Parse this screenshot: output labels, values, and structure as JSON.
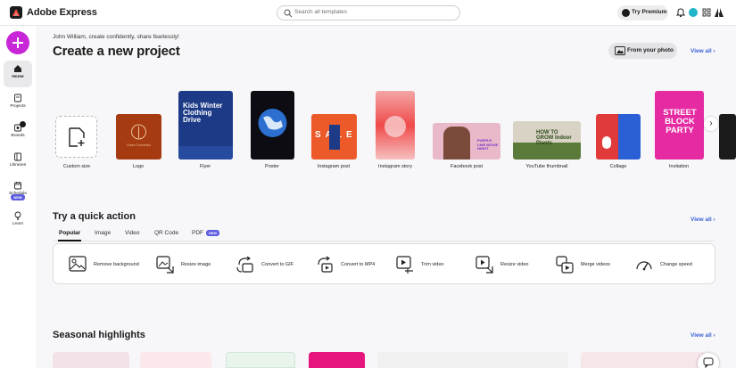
{
  "app": {
    "name": "Adobe Express"
  },
  "header": {
    "search_placeholder": "Search all templates",
    "premium_label": "Try Premium"
  },
  "sidebar": {
    "create_label": "+",
    "items": [
      {
        "label": "Home",
        "icon": "home-icon",
        "active": true
      },
      {
        "label": "Projects",
        "icon": "projects-icon"
      },
      {
        "label": "Brands",
        "icon": "brands-icon"
      },
      {
        "label": "Libraries",
        "icon": "libraries-icon"
      },
      {
        "label": "Schedule",
        "icon": "schedule-icon"
      },
      {
        "label": "Learn",
        "icon": "learn-icon"
      }
    ],
    "schedule_badge": "NEW"
  },
  "main": {
    "greeting": "John William, create confidently, share fearlessly!",
    "title": "Create a new project",
    "from_photo": "From your photo",
    "view_all": "View all",
    "templates": [
      {
        "label": "Custom size"
      },
      {
        "label": "Logo",
        "text": "Green Cosmetics"
      },
      {
        "label": "Flyer",
        "text": "Kids Winter Clothing Drive"
      },
      {
        "label": "Poster"
      },
      {
        "label": "Instagram post",
        "text": "SALE"
      },
      {
        "label": "Instagram story"
      },
      {
        "label": "Facebook post",
        "text": "PURPLE LINE MOVIE NIGHT"
      },
      {
        "label": "YouTube thumbnail",
        "text": "HOW TO GROW Indoor Plants"
      },
      {
        "label": "Collage"
      },
      {
        "label": "Invitation",
        "text": "STREET BLOCK PARTY"
      }
    ],
    "quick_action_title": "Try a quick action",
    "tabs": [
      {
        "label": "Popular",
        "active": true
      },
      {
        "label": "Image"
      },
      {
        "label": "Video"
      },
      {
        "label": "QR Code"
      },
      {
        "label": "PDF"
      }
    ],
    "pdf_badge": "NEW",
    "quick_actions": [
      {
        "label": "Remove background",
        "icon": "remove-background-icon"
      },
      {
        "label": "Resize image",
        "icon": "resize-image-icon"
      },
      {
        "label": "Convert to GIF",
        "icon": "convert-gif-icon"
      },
      {
        "label": "Convert to MP4",
        "icon": "convert-mp4-icon"
      },
      {
        "label": "Trim video",
        "icon": "trim-video-icon"
      },
      {
        "label": "Resize video",
        "icon": "resize-video-icon"
      },
      {
        "label": "Merge videos",
        "icon": "merge-videos-icon"
      },
      {
        "label": "Change speed",
        "icon": "change-speed-icon"
      }
    ],
    "seasonal_title": "Seasonal highlights"
  },
  "colors": {
    "accent": "#c827d8",
    "link": "#3b63d6",
    "badge": "#5c5ce0"
  }
}
